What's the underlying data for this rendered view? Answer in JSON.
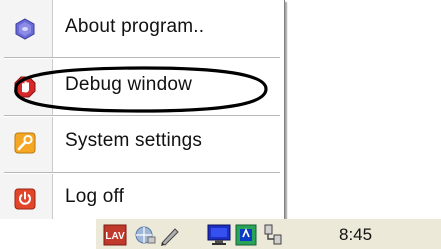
{
  "menu": {
    "items": [
      {
        "label": "About program..",
        "icon": "about-hexagon-icon",
        "color": "#6b6bd8"
      },
      {
        "label": "Debug window",
        "icon": "debug-stop-icon",
        "color": "#d62828"
      },
      {
        "label": "System settings",
        "icon": "wrench-icon",
        "color": "#f5a623"
      },
      {
        "label": "Log off",
        "icon": "power-icon",
        "color": "#e2462a"
      }
    ],
    "highlighted_item": "Debug window"
  },
  "tray": {
    "icons": [
      {
        "name": "lav-tray-icon",
        "text": "LAV",
        "color": "#c0392b"
      },
      {
        "name": "network-tray-icon"
      },
      {
        "name": "pen-tray-icon"
      },
      {
        "name": "monitor-tray-icon"
      },
      {
        "name": "settings-tray-icon"
      },
      {
        "name": "connection-tray-icon"
      }
    ],
    "clock": "8:45"
  }
}
